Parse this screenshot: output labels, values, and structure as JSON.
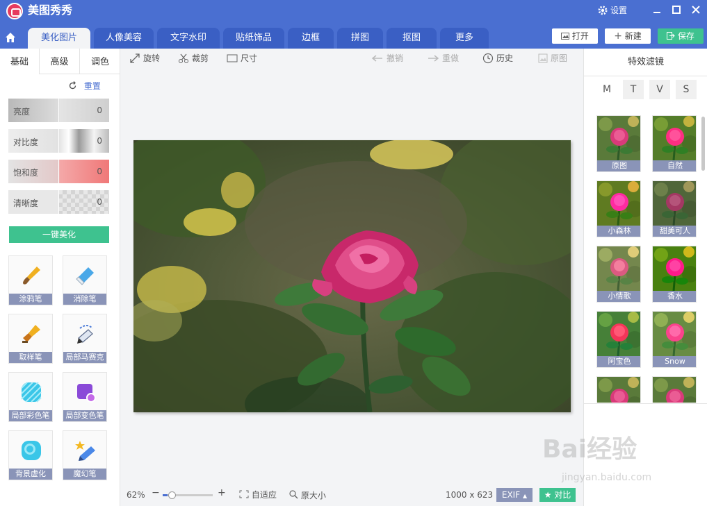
{
  "app": {
    "title": "美图秀秀",
    "settings_label": "设置"
  },
  "tabs": [
    {
      "label": "美化图片",
      "active": true
    },
    {
      "label": "人像美容"
    },
    {
      "label": "文字水印"
    },
    {
      "label": "贴纸饰品"
    },
    {
      "label": "边框"
    },
    {
      "label": "拼图"
    },
    {
      "label": "抠图"
    },
    {
      "label": "更多"
    }
  ],
  "top_buttons": {
    "open": "打开",
    "new": "新建",
    "save": "保存"
  },
  "left_tabs": [
    "基础",
    "高级",
    "调色"
  ],
  "reset_label": "重置",
  "sliders": [
    {
      "label": "亮度",
      "value": "0"
    },
    {
      "label": "对比度",
      "value": "0"
    },
    {
      "label": "饱和度",
      "value": "0"
    },
    {
      "label": "清晰度",
      "value": "0"
    }
  ],
  "one_key_label": "一键美化",
  "tools": [
    {
      "label": "涂鸦笔",
      "icon": "paint-brush-icon"
    },
    {
      "label": "消除笔",
      "icon": "eraser-icon"
    },
    {
      "label": "取样笔",
      "icon": "sample-brush-icon"
    },
    {
      "label": "局部马赛克",
      "icon": "mosaic-pen-icon"
    },
    {
      "label": "局部彩色笔",
      "icon": "color-pen-icon"
    },
    {
      "label": "局部变色笔",
      "icon": "recolor-pen-icon"
    },
    {
      "label": "背景虚化",
      "icon": "blur-background-icon"
    },
    {
      "label": "魔幻笔",
      "icon": "magic-pen-icon"
    }
  ],
  "toolbar": {
    "rotate": "旋转",
    "crop": "裁剪",
    "size": "尺寸",
    "undo": "撤销",
    "redo": "重做",
    "history": "历史",
    "original": "原图"
  },
  "status": {
    "zoom": "62%",
    "zoom_level": 0.1,
    "fit": "自适应",
    "actual": "原大小",
    "dimensions": "1000 x 623",
    "exif": "EXIF",
    "compare": "对比"
  },
  "right_panel": {
    "title": "特效滤镜",
    "categories": [
      "M",
      "T",
      "V",
      "S"
    ],
    "filters": [
      "原图",
      "自然",
      "小森林",
      "甜美可人",
      "小情歌",
      "香水",
      "阿宝色",
      "Snow"
    ]
  },
  "watermark": {
    "text": "Bai经验",
    "url": "jingyan.baidu.com"
  },
  "colors": {
    "brand": "#4a6fd1",
    "accent_green": "#3ec28f",
    "label_gray": "#8a94b8"
  }
}
